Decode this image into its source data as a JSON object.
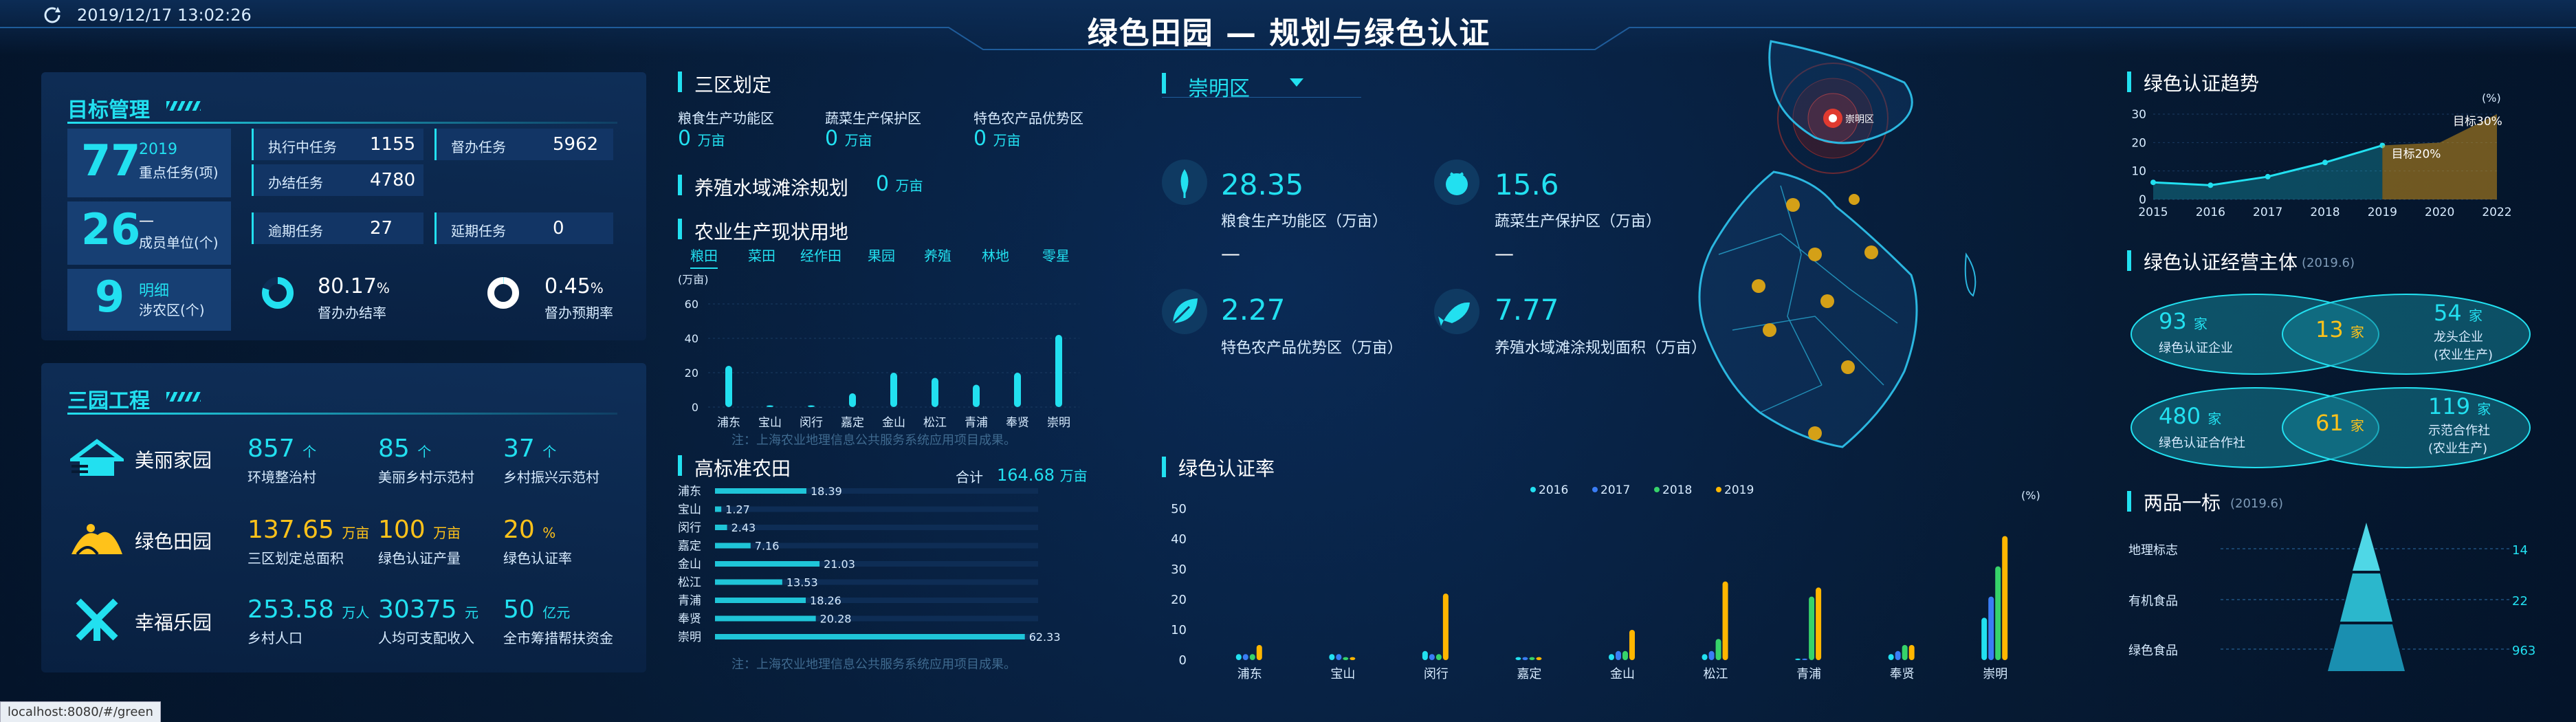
{
  "header": {
    "datetime": "2019/12/17 13:02:26",
    "title": "绿色田园 — 规划与绿色认证"
  },
  "status_bar": {
    "url": "localhost:8080/#/green"
  },
  "target": {
    "title": "目标管理",
    "big1": {
      "value": "77",
      "year": "2019",
      "label": "重点任务(项)"
    },
    "big2": {
      "value": "26",
      "dash": "—",
      "label": "成员单位(个)"
    },
    "big3": {
      "value": "9",
      "sub": "明细",
      "label": "涉农区(个)"
    },
    "stats": [
      {
        "label": "执行中任务",
        "value": "1155"
      },
      {
        "label": "督办任务",
        "value": "5962"
      },
      {
        "label": "办结任务",
        "value": "4780"
      },
      {
        "label": "逾期任务",
        "value": "27"
      },
      {
        "label": "延期任务",
        "value": "0"
      }
    ],
    "rate1": {
      "value": "80.17",
      "unit": "%",
      "label": "督办办结率",
      "fraction": 0.8017
    },
    "rate2": {
      "value": "0.45",
      "unit": "%",
      "label": "督办预期率",
      "fraction": 0.0045
    }
  },
  "three": {
    "title": "三园工程",
    "rows": [
      {
        "name": "美丽家园",
        "icon": "house-icon",
        "items": [
          {
            "v": "857",
            "u": "个",
            "l": "环境整治村"
          },
          {
            "v": "85",
            "u": "个",
            "l": "美丽乡村示范村"
          },
          {
            "v": "37",
            "u": "个",
            "l": "乡村振兴示范村"
          }
        ]
      },
      {
        "name": "绿色田园",
        "icon": "field-icon",
        "items": [
          {
            "v": "137.65",
            "u": "万亩",
            "l": "三区划定总面积"
          },
          {
            "v": "100",
            "u": "万亩",
            "l": "绿色认证产量"
          },
          {
            "v": "20",
            "u": "%",
            "l": "绿色认证率"
          }
        ]
      },
      {
        "name": "幸福乐园",
        "icon": "windmill-icon",
        "items": [
          {
            "v": "253.58",
            "u": "万人",
            "l": "乡村人口"
          },
          {
            "v": "30375",
            "u": "元",
            "l": "人均可支配收入"
          },
          {
            "v": "50",
            "u": "亿元",
            "l": "全市筹措帮扶资金"
          }
        ]
      }
    ]
  },
  "zones": {
    "title": "三区划定",
    "items": [
      {
        "label": "粮食生产功能区",
        "value": "0",
        "unit": "万亩"
      },
      {
        "label": "蔬菜生产保护区",
        "value": "0",
        "unit": "万亩"
      },
      {
        "label": "特色农产品优势区",
        "value": "0",
        "unit": "万亩"
      }
    ]
  },
  "aqua": {
    "title": "养殖水域滩涂规划",
    "value": "0",
    "unit": "万亩"
  },
  "agri": {
    "title": "农业生产现状用地",
    "tabs": [
      "粮田",
      "菜田",
      "经作田",
      "果园",
      "养殖",
      "林地",
      "零星"
    ],
    "note": "注：上海农业地理信息公共服务系统应用项目成果。"
  },
  "hs": {
    "title": "高标准农田",
    "total_label": "合计",
    "total": "164.68",
    "unit": "万亩",
    "note": "注：上海农业地理信息公共服务系统应用项目成果。"
  },
  "district": {
    "name": "崇明区",
    "metrics": [
      {
        "value": "28.35",
        "label": "粮食生产功能区（万亩）",
        "dash": "—",
        "icon": "grain-icon"
      },
      {
        "value": "15.6",
        "label": "蔬菜生产保护区（万亩）",
        "dash": "—",
        "icon": "tomato-icon"
      },
      {
        "value": "2.27",
        "label": "特色农产品优势区（万亩）",
        "icon": "leaf-icon"
      },
      {
        "value": "7.77",
        "label": "养殖水域滩涂规划面积（万亩）",
        "icon": "fish-icon"
      }
    ]
  },
  "map": {
    "marker_label": "崇明区"
  },
  "cert_rate": {
    "title": "绿色认证率"
  },
  "trend": {
    "title": "绿色认证趋势"
  },
  "entity": {
    "title": "绿色认证经营主体",
    "date": "(2019.6)",
    "left": [
      {
        "v": "93",
        "u": "家",
        "l": "绿色认证企业"
      },
      {
        "v": "480",
        "u": "家",
        "l": "绿色认证合作社"
      }
    ],
    "mid": [
      {
        "v": "13",
        "u": "家"
      },
      {
        "v": "61",
        "u": "家"
      }
    ],
    "right": [
      {
        "v": "54",
        "u": "家",
        "l": "龙头企业",
        "l2": "(农业生产)"
      },
      {
        "v": "119",
        "u": "家",
        "l": "示范合作社",
        "l2": "(农业生产)"
      }
    ]
  },
  "twoproduct": {
    "title": "两品一标",
    "date": "(2019.6)",
    "items": [
      {
        "label": "地理标志",
        "value": "14"
      },
      {
        "label": "有机食品",
        "value": "22"
      },
      {
        "label": "绿色食品",
        "value": "963"
      }
    ]
  },
  "chart_data": [
    {
      "type": "bar",
      "title": "农业生产现状用地",
      "ylabel": "(万亩)",
      "ylim": [
        0,
        60
      ],
      "yticks": [
        0,
        20,
        40,
        60
      ],
      "categories": [
        "浦东",
        "宝山",
        "闵行",
        "嘉定",
        "金山",
        "松江",
        "青浦",
        "奉贤",
        "崇明"
      ],
      "values": [
        24,
        1,
        1,
        8,
        20,
        17,
        13,
        20,
        42
      ]
    },
    {
      "type": "bar",
      "orientation": "horizontal",
      "title": "高标准农田",
      "categories": [
        "浦东",
        "宝山",
        "闵行",
        "嘉定",
        "金山",
        "松江",
        "青浦",
        "奉贤",
        "崇明"
      ],
      "values": [
        18.39,
        1.27,
        2.43,
        7.16,
        21.03,
        13.53,
        18.26,
        20.28,
        62.33
      ]
    },
    {
      "type": "bar",
      "title": "绿色认证率",
      "ylabel": "(%)",
      "ylim": [
        0,
        50
      ],
      "yticks": [
        0,
        10,
        20,
        30,
        40,
        50
      ],
      "categories": [
        "浦东",
        "宝山",
        "闵行",
        "嘉定",
        "金山",
        "松江",
        "青浦",
        "奉贤",
        "崇明"
      ],
      "series": [
        {
          "name": "2016",
          "color": "#22e0f0",
          "values": [
            2,
            2,
            3,
            1,
            2,
            2,
            0.5,
            2,
            14
          ]
        },
        {
          "name": "2017",
          "color": "#3a7df5",
          "values": [
            2,
            2,
            2,
            1,
            3,
            3,
            0.5,
            3,
            21
          ]
        },
        {
          "name": "2018",
          "color": "#36d36a",
          "values": [
            2,
            1,
            2,
            1,
            3,
            7,
            21,
            5,
            31
          ]
        },
        {
          "name": "2019",
          "color": "#ffb600",
          "values": [
            5,
            1,
            22,
            1,
            10,
            26,
            24,
            5,
            41
          ]
        }
      ]
    },
    {
      "type": "area",
      "title": "绿色认证趋势",
      "ylabel": "(%)",
      "ylim": [
        0,
        30
      ],
      "yticks": [
        0,
        10,
        20,
        30
      ],
      "categories": [
        "2015",
        "2016",
        "2017",
        "2018",
        "2019",
        "2020",
        "2022"
      ],
      "series": [
        {
          "name": "actual",
          "values": [
            6,
            5,
            8,
            13,
            19,
            null,
            null
          ]
        },
        {
          "name": "target",
          "values": [
            null,
            null,
            null,
            null,
            19,
            20,
            30
          ]
        }
      ],
      "annotations": [
        "目标30%",
        "目标20%"
      ]
    }
  ]
}
